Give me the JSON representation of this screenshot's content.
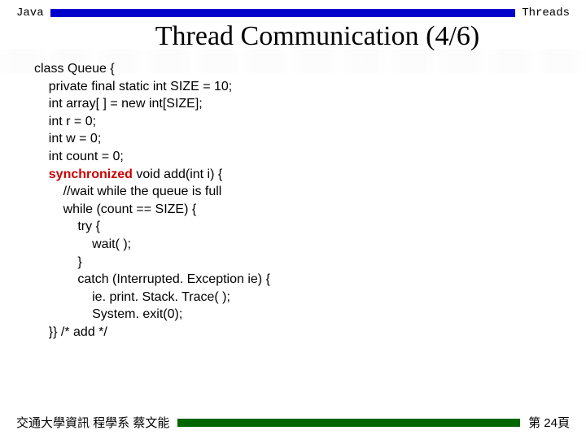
{
  "header": {
    "left": "Java",
    "right": "Threads"
  },
  "title": "Thread Communication (4/6)",
  "code": {
    "l01": "class Queue {",
    "l02": "    private final static int SIZE = 10;",
    "l03": "    int array[ ] = new int[SIZE];",
    "l04": "    int r = 0;",
    "l05": "    int w = 0;",
    "l06": "    int count = 0;",
    "l07a": "    ",
    "l07kw": "synchronized",
    "l07b": " void add(int i) {",
    "l08": "        //wait while the queue is full",
    "l09": "        while (count == SIZE) {",
    "l10": "            try {",
    "l11": "                wait( );",
    "l12": "            }",
    "l13": "            catch (Interrupted. Exception ie) {",
    "l14": "                ie. print. Stack. Trace( );",
    "l15": "                System. exit(0);",
    "l16": "    }} /* add */"
  },
  "footer": {
    "left": "交通大學資訊 程學系 蔡文能",
    "right": "第 24頁"
  }
}
